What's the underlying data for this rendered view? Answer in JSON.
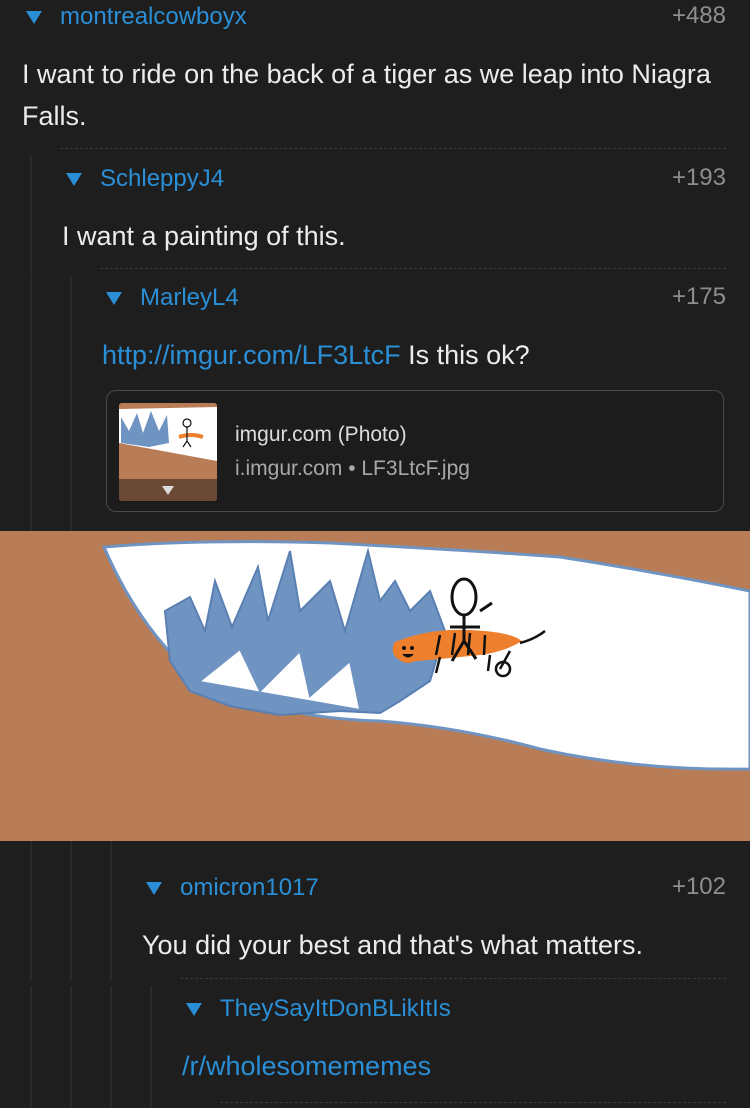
{
  "comments": [
    {
      "user": "montrealcowboyx",
      "score": "+488",
      "text": "I want to ride on the back of a tiger as we leap into Niagra Falls."
    },
    {
      "user": "SchleppyJ4",
      "score": "+193",
      "text": "I want a painting of this."
    },
    {
      "user": "MarleyL4",
      "score": "+175",
      "link": "http://imgur.com/LF3LtcF",
      "text_after_link": " Is this ok?"
    },
    {
      "user": "omicron1017",
      "score": "+102",
      "text": "You did your best and that's what matters."
    },
    {
      "user": "TheySayItDonBLikItIs",
      "score": "",
      "text": "/r/wholesomememes"
    }
  ],
  "preview": {
    "title": "imgur.com (Photo)",
    "source": "i.imgur.com • LF3LtcF.jpg"
  },
  "colors": {
    "background": "#1e1e1f",
    "accent": "#2a8fd6",
    "score": "#8e8e8e",
    "image_brown": "#b87c56",
    "image_blue": "#7094c2",
    "tiger_orange": "#ee7f2d"
  },
  "icons": {
    "collapse": "collapse-triangle-icon",
    "expand": "expand-arrow-icon"
  }
}
